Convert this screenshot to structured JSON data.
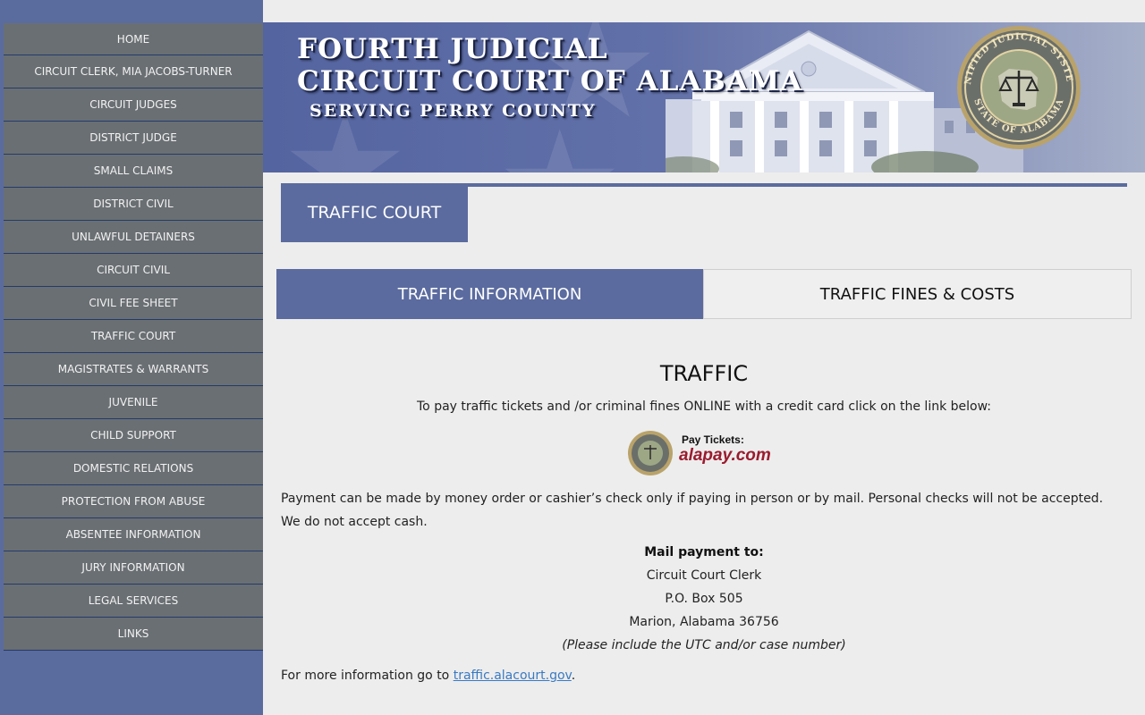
{
  "nav": [
    "HOME",
    "CIRCUIT CLERK, MIA JACOBS-TURNER",
    "CIRCUIT JUDGES",
    "DISTRICT JUDGE",
    "SMALL CLAIMS",
    "DISTRICT CIVIL",
    "UNLAWFUL DETAINERS",
    "CIRCUIT CIVIL",
    "CIVIL FEE SHEET",
    "TRAFFIC COURT",
    "MAGISTRATES & WARRANTS",
    "JUVENILE",
    "CHILD SUPPORT",
    "DOMESTIC RELATIONS",
    "PROTECTION FROM ABUSE",
    "ABSENTEE INFORMATION",
    "JURY INFORMATION",
    "LEGAL SERVICES",
    "LINKS"
  ],
  "banner": {
    "line1": "FOURTH  JUDICIAL",
    "line2": "CIRCUIT COURT OF ALABAMA",
    "line3": "SERVING  PERRY  COUNTY",
    "seal_top": "UNIFIED JUDICIAL SYSTEM",
    "seal_bottom": "STATE OF ALABAMA"
  },
  "section": {
    "title": "TRAFFIC COURT"
  },
  "tabs": {
    "info": "TRAFFIC INFORMATION",
    "fines": "TRAFFIC FINES & COSTS"
  },
  "content": {
    "heading": "TRAFFIC",
    "intro": "To pay traffic tickets and /or criminal fines ONLINE with a credit card click on the link below:",
    "pay_label": "Pay Tickets:",
    "pay_site": "alapay.com",
    "payment_note": "Payment can be made by money order or cashier’s check only if paying in person or by mail. Personal checks will not be accepted. We do not accept cash.",
    "mail_heading": "Mail payment to:",
    "mail_line1": "Circuit Court Clerk",
    "mail_line2": "P.O. Box 505",
    "mail_line3": "Marion, Alabama 36756",
    "mail_note": "(Please include the UTC and/or case number)",
    "more_prefix": "For more information go to ",
    "more_link": "traffic.alacourt.gov",
    "more_suffix": "."
  },
  "colors": {
    "sidebar_bg": "#5a6b9e",
    "nav_item_bg": "#6a6f73",
    "accent": "#5b6b9f",
    "page_bg": "#ededed",
    "link": "#3a7ac2"
  }
}
